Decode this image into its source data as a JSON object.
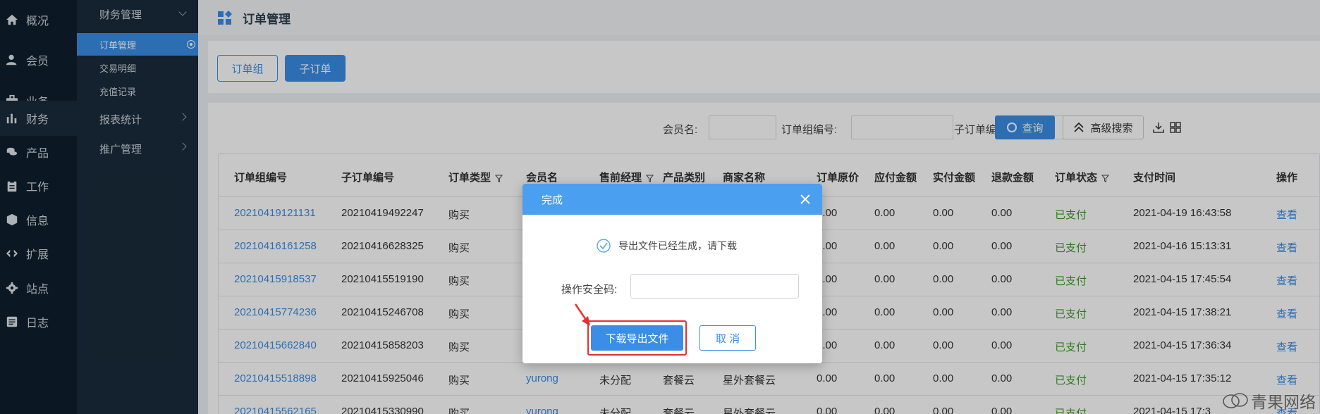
{
  "sidebar": {
    "items": [
      {
        "label": "概况",
        "icon": "home-icon"
      },
      {
        "label": "会员",
        "icon": "user-icon"
      },
      {
        "label": "业务",
        "icon": "briefcase-icon"
      },
      {
        "label": "财务",
        "icon": "bar-chart-icon"
      },
      {
        "label": "产品",
        "icon": "coins-icon"
      },
      {
        "label": "工作",
        "icon": "clipboard-icon"
      },
      {
        "label": "信息",
        "icon": "cube-icon"
      },
      {
        "label": "扩展",
        "icon": "code-icon"
      },
      {
        "label": "站点",
        "icon": "gear-icon"
      },
      {
        "label": "日志",
        "icon": "log-icon"
      }
    ],
    "active_index": 3
  },
  "subnav": {
    "group1": "财务管理",
    "sub_items": [
      "订单管理",
      "交易明细",
      "充值记录"
    ],
    "group2": "报表统计",
    "group3": "推广管理"
  },
  "header": {
    "title": "订单管理"
  },
  "tabs": {
    "order_group": "订单组",
    "sub_order": "子订单"
  },
  "filters": {
    "member_label": "会员名:",
    "group_no_label": "订单组编号:",
    "sub_no_label": "子订单编号:",
    "search_label": "查询",
    "advanced_label": "高级搜索"
  },
  "table": {
    "columns": [
      "订单组编号",
      "子订单编号",
      "订单类型",
      "会员名",
      "售前经理",
      "产品类别",
      "商家名称",
      "订单原价",
      "应付金额",
      "实付金额",
      "退款金额",
      "订单状态",
      "支付时间",
      "操作"
    ],
    "rows": [
      {
        "group_no": "20210419121131",
        "sub_no": "20210419492247",
        "type": "购买",
        "member": "",
        "manager": "",
        "category": "",
        "merchant": "",
        "original": "0.00",
        "payable": "0.00",
        "paid": "0.00",
        "refund": "0.00",
        "status": "已支付",
        "time": "2021-04-19 16:43:58",
        "action": "查看"
      },
      {
        "group_no": "20210416161258",
        "sub_no": "20210416628325",
        "type": "购买",
        "member": "",
        "manager": "",
        "category": "",
        "merchant": "",
        "original": "0.00",
        "payable": "0.00",
        "paid": "0.00",
        "refund": "0.00",
        "status": "已支付",
        "time": "2021-04-16 15:13:31",
        "action": "查看"
      },
      {
        "group_no": "20210415918537",
        "sub_no": "20210415519190",
        "type": "购买",
        "member": "",
        "manager": "",
        "category": "",
        "merchant": "",
        "original": "0.00",
        "payable": "0.00",
        "paid": "0.00",
        "refund": "0.00",
        "status": "已支付",
        "time": "2021-04-15 17:45:54",
        "action": "查看"
      },
      {
        "group_no": "20210415774236",
        "sub_no": "20210415246708",
        "type": "购买",
        "member": "",
        "manager": "",
        "category": "",
        "merchant": "",
        "original": "0.00",
        "payable": "0.00",
        "paid": "0.00",
        "refund": "0.00",
        "status": "已支付",
        "time": "2021-04-15 17:38:21",
        "action": "查看"
      },
      {
        "group_no": "20210415662840",
        "sub_no": "20210415858203",
        "type": "购买",
        "member": "",
        "manager": "",
        "category": "",
        "merchant": "",
        "original": "0.00",
        "payable": "0.00",
        "paid": "0.00",
        "refund": "0.00",
        "status": "已支付",
        "time": "2021-04-15 17:36:34",
        "action": "查看"
      },
      {
        "group_no": "20210415518898",
        "sub_no": "20210415925046",
        "type": "购买",
        "member": "yurong",
        "manager": "未分配",
        "category": "套餐云",
        "merchant": "星外套餐云",
        "original": "0.00",
        "payable": "0.00",
        "paid": "0.00",
        "refund": "0.00",
        "status": "已支付",
        "time": "2021-04-15 17:35:12",
        "action": "查看"
      },
      {
        "group_no": "20210415562165",
        "sub_no": "20210415330990",
        "type": "购买",
        "member": "yurong",
        "manager": "未分配",
        "category": "套餐云",
        "merchant": "星外套餐云",
        "original": "0.00",
        "payable": "0.00",
        "paid": "0.00",
        "refund": "0.00",
        "status": "已支付",
        "time": "2021-04-15 17:3",
        "action": "查看"
      }
    ]
  },
  "dialog": {
    "title": "完成",
    "message": "导出文件已经生成，请下载",
    "code_label": "操作安全码:",
    "download_label": "下载导出文件",
    "cancel_label": "取 消"
  },
  "watermark": {
    "text": "青果网络"
  },
  "colors": {
    "accent": "#3a8ee6",
    "sidebar_bg": "#0f1e2c",
    "subnav_bg": "#1a2b3b",
    "paid": "#3a9b2a",
    "highlight": "#e53030"
  }
}
